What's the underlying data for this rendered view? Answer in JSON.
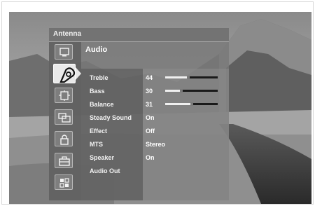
{
  "menu": {
    "title": "Antenna",
    "section": "Audio",
    "icons": [
      {
        "name": "picture-icon",
        "selected": false
      },
      {
        "name": "audio-icon",
        "selected": true
      },
      {
        "name": "channel-icon",
        "selected": false
      },
      {
        "name": "screen-settings-icon",
        "selected": false
      },
      {
        "name": "lock-icon",
        "selected": false
      },
      {
        "name": "setup-toolbox-icon",
        "selected": false
      },
      {
        "name": "apps-grid-icon",
        "selected": false
      }
    ],
    "rows": [
      {
        "label": "Treble",
        "value": "44",
        "slider": 0.44
      },
      {
        "label": "Bass",
        "value": "30",
        "slider": 0.3
      },
      {
        "label": "Balance",
        "value": "31",
        "slider": 0.5
      },
      {
        "label": "Steady Sound",
        "value": "On"
      },
      {
        "label": "Effect",
        "value": "Off"
      },
      {
        "label": "MTS",
        "value": "Stereo"
      },
      {
        "label": "Speaker",
        "value": "On"
      },
      {
        "label": "Audio Out",
        "value": ""
      }
    ]
  }
}
